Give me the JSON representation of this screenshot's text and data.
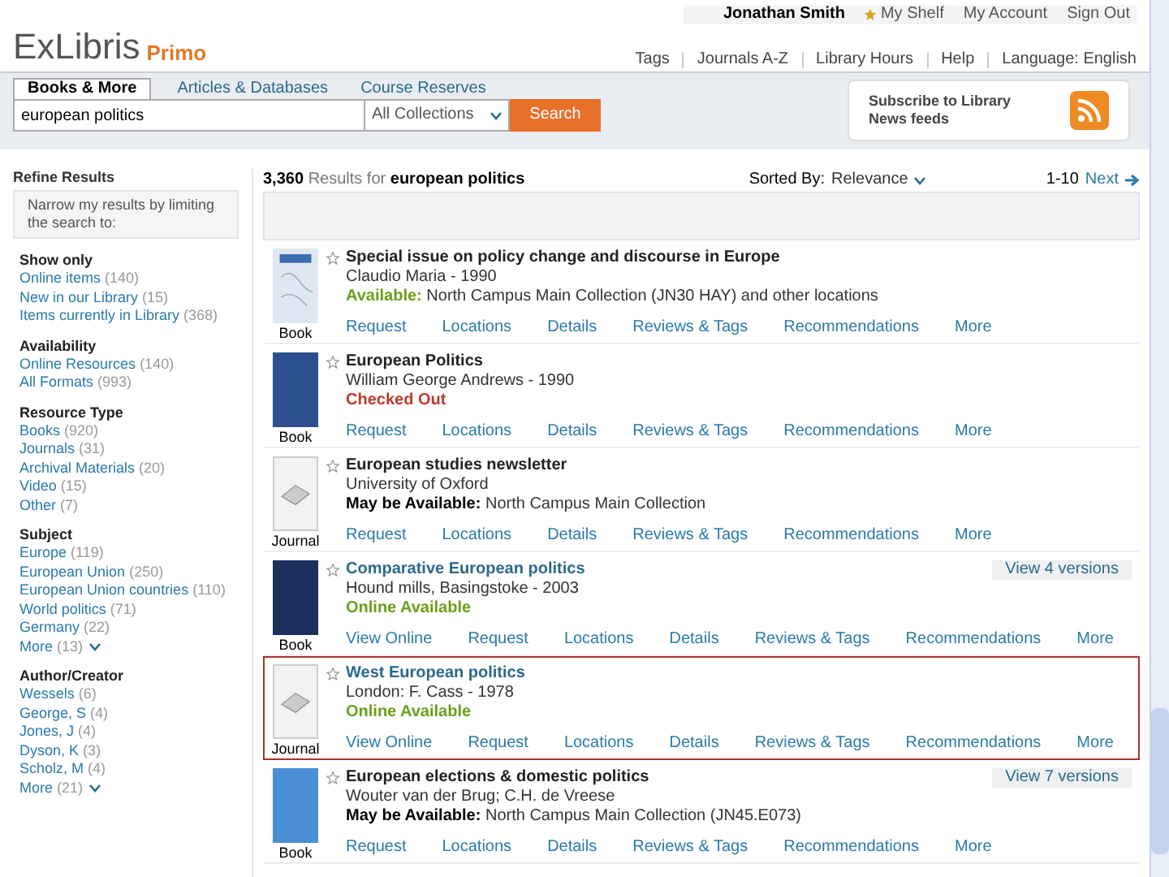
{
  "header": {
    "user": "Jonathan Smith",
    "user_links": [
      "My Shelf",
      "My Account",
      "Sign Out"
    ],
    "logo": {
      "brand": "ExLibris",
      "product": "Primo"
    },
    "nav_links": [
      "Tags",
      "Journals A-Z",
      "Library Hours",
      "Help",
      "Language: English"
    ]
  },
  "search": {
    "tabs": [
      {
        "label": "Books & More",
        "selected": true
      },
      {
        "label": "Articles & Databases",
        "selected": false
      },
      {
        "label": "Course Reserves",
        "selected": false
      }
    ],
    "query": "european politics",
    "scope": "All Collections",
    "button": "Search"
  },
  "subscribe": {
    "text": "Subscribe to Library News feeds"
  },
  "sidebar": {
    "title": "Refine Results",
    "hint": "Narrow my results by limiting the search to:",
    "groups": [
      {
        "title": "Show only",
        "items": [
          {
            "label": "Online items",
            "count": "(140)"
          },
          {
            "label": "New in our Library",
            "count": "(15)"
          },
          {
            "label": "Items currently in Library",
            "count": "(368)"
          }
        ]
      },
      {
        "title": "Availability",
        "items": [
          {
            "label": "Online Resources",
            "count": "(140)"
          },
          {
            "label": "All Formats",
            "count": "(993)"
          }
        ]
      },
      {
        "title": "Resource Type",
        "items": [
          {
            "label": "Books",
            "count": "(920)"
          },
          {
            "label": "Journals",
            "count": "(31)"
          },
          {
            "label": "Archival Materials",
            "count": "(20)"
          },
          {
            "label": "Video",
            "count": "(15)"
          },
          {
            "label": "Other",
            "count": "(7)"
          }
        ]
      },
      {
        "title": "Subject",
        "items": [
          {
            "label": "Europe",
            "count": "(119)"
          },
          {
            "label": "European Union",
            "count": "(250)"
          },
          {
            "label": "European Union countries",
            "count": "(110)"
          },
          {
            "label": "World politics",
            "count": "(71)"
          },
          {
            "label": "Germany",
            "count": "(22)"
          },
          {
            "label": "More",
            "count": "(13)",
            "more": true
          }
        ]
      },
      {
        "title": "Author/Creator",
        "items": [
          {
            "label": "Wessels",
            "count": "(6)"
          },
          {
            "label": "George, S",
            "count": "(4)"
          },
          {
            "label": "Jones, J",
            "count": "(4)"
          },
          {
            "label": "Dyson, K",
            "count": "(3)"
          },
          {
            "label": "Scholz, M",
            "count": "(4)"
          },
          {
            "label": "More",
            "count": "(21)",
            "more": true
          }
        ]
      }
    ]
  },
  "results_bar": {
    "count": "3,360",
    "results_for": "Results for",
    "query": "european politics",
    "sort_label": "Sorted By:",
    "sort_value": "Relevance",
    "range": "1-10",
    "next": "Next"
  },
  "results": [
    {
      "title": "Special issue on policy change and discourse in Europe",
      "linked": false,
      "author": "Claudio Maria - 1990",
      "status": {
        "kind": "available",
        "label": "Available:",
        "text": "North Campus Main Collection (JN30 HAY) and other locations"
      },
      "type": "Book",
      "cover": {
        "kind": "illustrated",
        "color": "#dfe8f2"
      },
      "actions": [
        "Request",
        "Locations",
        "Details",
        "Reviews & Tags",
        "Recommendations",
        "More"
      ],
      "selected": false
    },
    {
      "title": "European Politics",
      "linked": false,
      "author": "William George Andrews - 1990",
      "status": {
        "kind": "checked_out",
        "label": "Checked Out"
      },
      "type": "Book",
      "cover": {
        "kind": "plain",
        "color": "#2c4f8f"
      },
      "actions": [
        "Request",
        "Locations",
        "Details",
        "Reviews & Tags",
        "Recommendations",
        "More"
      ],
      "selected": false
    },
    {
      "title": "European studies newsletter",
      "linked": false,
      "author": "University of Oxford",
      "status": {
        "kind": "maybe",
        "label": "May be Available:",
        "text": "North Campus Main Collection"
      },
      "type": "Journal",
      "cover": {
        "kind": "generic",
        "color": "#f2f2f2"
      },
      "actions": [
        "Request",
        "Locations",
        "Details",
        "Reviews & Tags",
        "Recommendations",
        "More"
      ],
      "selected": false
    },
    {
      "title": "Comparative European politics",
      "linked": true,
      "author": "Hound mills, Basingstoke - 2003",
      "status": {
        "kind": "online",
        "label": "Online Available"
      },
      "type": "Book",
      "cover": {
        "kind": "plain",
        "color": "#1d2f5c"
      },
      "actions": [
        "View Online",
        "Request",
        "Locations",
        "Details",
        "Reviews & Tags",
        "Recommendations",
        "More"
      ],
      "versions": "View 4 versions",
      "selected": false
    },
    {
      "title": "West European politics",
      "linked": true,
      "author": "London: F. Cass - 1978",
      "status": {
        "kind": "online",
        "label": "Online Available"
      },
      "type": "Journal",
      "cover": {
        "kind": "generic",
        "color": "#f2f2f2"
      },
      "actions": [
        "View Online",
        "Request",
        "Locations",
        "Details",
        "Reviews & Tags",
        "Recommendations",
        "More"
      ],
      "selected": true
    },
    {
      "title": "European elections & domestic politics",
      "linked": false,
      "author": "Wouter van der Brug; C.H. de Vreese",
      "status": {
        "kind": "maybe",
        "label": "May be Available:",
        "text": "North Campus Main Collection (JN45.E073)"
      },
      "type": "Book",
      "cover": {
        "kind": "plain",
        "color": "#4a8fd6"
      },
      "actions": [
        "Request",
        "Locations",
        "Details",
        "Reviews & Tags",
        "Recommendations",
        "More"
      ],
      "versions": "View 7 versions",
      "selected": false
    }
  ]
}
